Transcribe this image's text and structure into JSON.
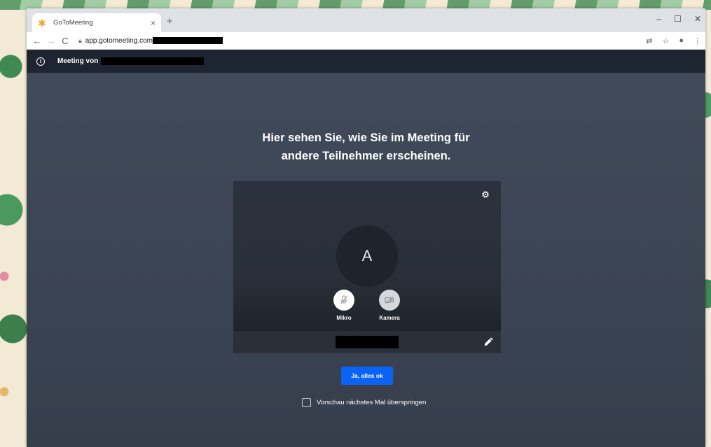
{
  "browser": {
    "tab_title": "GoToMeeting",
    "tab_close": "×",
    "new_tab": "+",
    "url": "app.gotomeeting.com",
    "window_controls": [
      "–",
      "☐",
      "✕"
    ]
  },
  "app": {
    "meeting_label": "Meeting von"
  },
  "main": {
    "headline_line1": "Hier sehen Sie, wie Sie im Meeting für",
    "headline_line2": "andere Teilnehmer erscheinen.",
    "avatar_initial": "A",
    "mic_label": "Mikro",
    "camera_label": "Kamera",
    "confirm_button": "Ja, alles ok",
    "skip_label": "Vorschau nächstes Mal überspringen"
  },
  "colors": {
    "app_header": "#1f2530",
    "stage_bg": "#3b4453",
    "primary_button": "#0b63f4",
    "favicon": "#f5a623"
  },
  "icons": [
    "info-icon",
    "gear-icon",
    "mic-off-icon",
    "camera-off-icon",
    "pencil-icon",
    "lock-icon",
    "translate-icon",
    "star-icon",
    "account-icon",
    "menu-dots-icon"
  ]
}
